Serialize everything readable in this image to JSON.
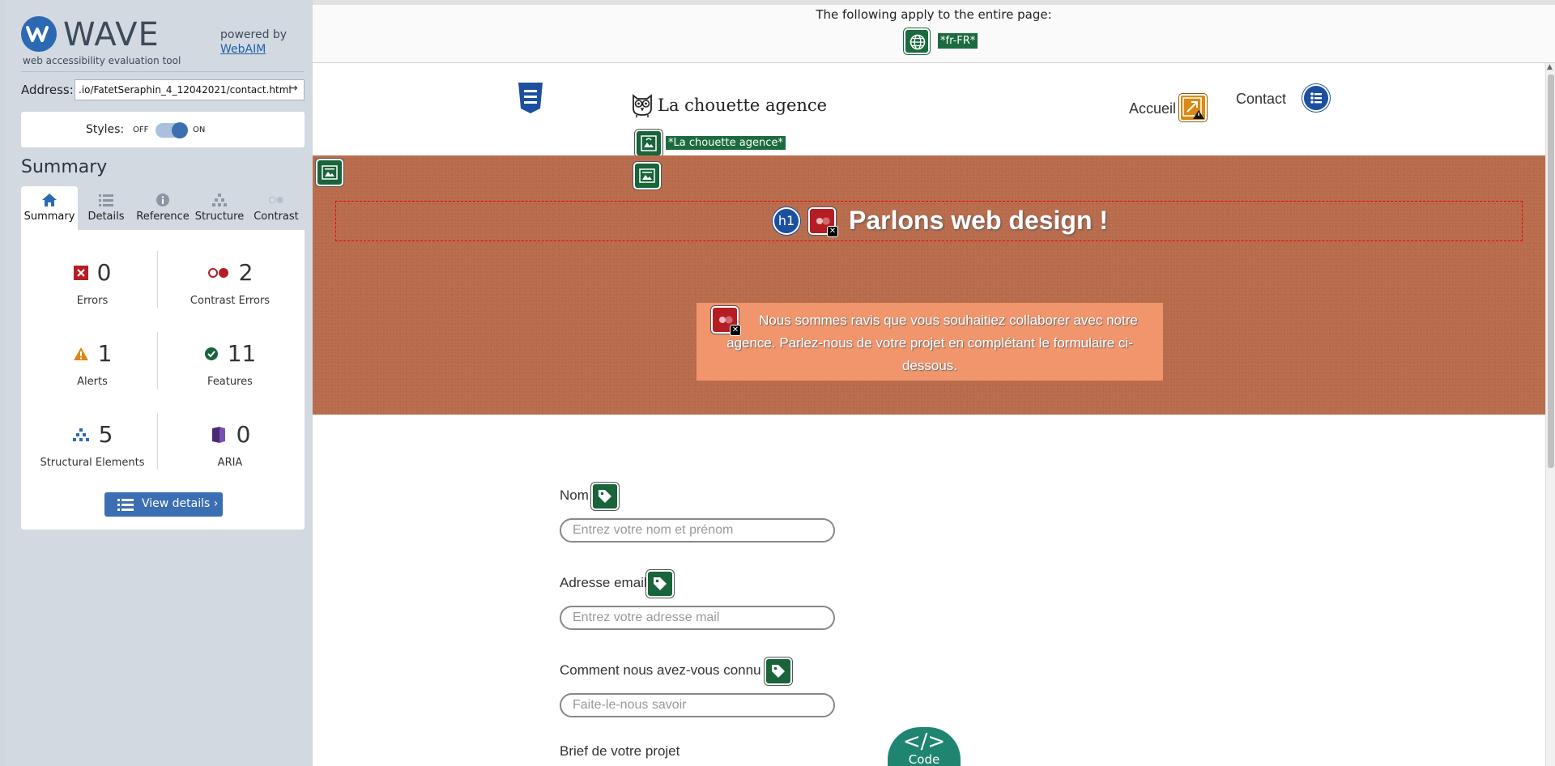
{
  "wave": {
    "logo_word": "WAVE",
    "logo_sub": "web accessibility evaluation tool",
    "powered_by": "powered by",
    "webaim_link": "WebAIM",
    "address_label": "Address:",
    "address_value": ".io/FatetSeraphin_4_12042021/contact.html",
    "styles_label": "Styles:",
    "styles_off": "OFF",
    "styles_on": "ON",
    "summary_title": "Summary",
    "tabs": [
      {
        "label": "Summary",
        "icon": "home-icon"
      },
      {
        "label": "Details",
        "icon": "list-icon"
      },
      {
        "label": "Reference",
        "icon": "info-icon"
      },
      {
        "label": "Structure",
        "icon": "hierarchy-icon"
      },
      {
        "label": "Contrast",
        "icon": "contrast-icon"
      }
    ],
    "stats": {
      "errors": {
        "count": "0",
        "label": "Errors"
      },
      "contrast_errors": {
        "count": "2",
        "label": "Contrast Errors"
      },
      "alerts": {
        "count": "1",
        "label": "Alerts"
      },
      "features": {
        "count": "11",
        "label": "Features"
      },
      "structural": {
        "count": "5",
        "label": "Structural Elements"
      },
      "aria": {
        "count": "0",
        "label": "ARIA"
      }
    },
    "view_details": "View details ›",
    "colors": {
      "accent": "#3b6eb2",
      "error": "#b51d25",
      "alert": "#d98a16",
      "feature": "#19643a",
      "aria": "#4b2b75"
    }
  },
  "banner": {
    "text": "The following apply to the entire page:",
    "lang_label": "*fr-FR*"
  },
  "site": {
    "brand": "La chouette agence",
    "brand_alt_label": "*La chouette agence*",
    "nav": {
      "accueil": "Accueil",
      "contact": "Contact"
    },
    "hero_title": "Parlons web design !",
    "hero_h1_tag": "h1",
    "hero_text": "Nous sommes ravis que vous souhaitiez collaborer avec notre agence. Parlez-nous de votre projet en complétant le formulaire ci-dessous.",
    "form": {
      "name_label": "Nom",
      "name_placeholder": "Entrez votre nom et prénom",
      "email_label": "Adresse email",
      "email_placeholder": "Entrez votre adresse mail",
      "source_label": "Comment nous avez-vous connu ?",
      "source_placeholder": "Faite-le-nous savoir",
      "brief_label": "Brief de votre projet"
    },
    "code_tab": {
      "symbol": "</>",
      "label": "Code"
    }
  }
}
